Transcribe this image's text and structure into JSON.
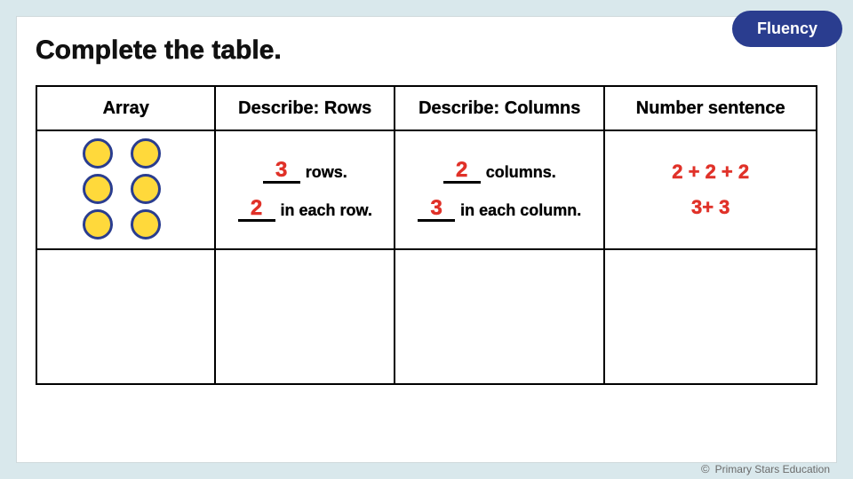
{
  "badge": "Fluency",
  "title": "Complete the table.",
  "headers": {
    "array": "Array",
    "rows": "Describe: Rows",
    "cols": "Describe: Columns",
    "num": "Number sentence"
  },
  "row1": {
    "rows_count": "3",
    "rows_suffix": "rows.",
    "in_each_row_count": "2",
    "in_each_row_suffix": "in each row.",
    "cols_count": "2",
    "cols_suffix": "columns.",
    "in_each_col_count": "3",
    "in_each_col_suffix": "in each column.",
    "num_sentence_a": "2 + 2 + 2",
    "num_sentence_b": "3+ 3"
  },
  "footer": "Primary Stars Education",
  "chart_data": {
    "type": "table",
    "title": "Complete the table.",
    "columns": [
      "Array",
      "Describe: Rows",
      "Describe: Columns",
      "Number sentence"
    ],
    "rows": [
      {
        "array": {
          "rows": 3,
          "cols": 2
        },
        "describe_rows": [
          "3 rows.",
          "2 in each row."
        ],
        "describe_columns": [
          "2 columns.",
          "3 in each column."
        ],
        "number_sentence": [
          "2 + 2 + 2",
          "3 + 3"
        ]
      }
    ]
  }
}
